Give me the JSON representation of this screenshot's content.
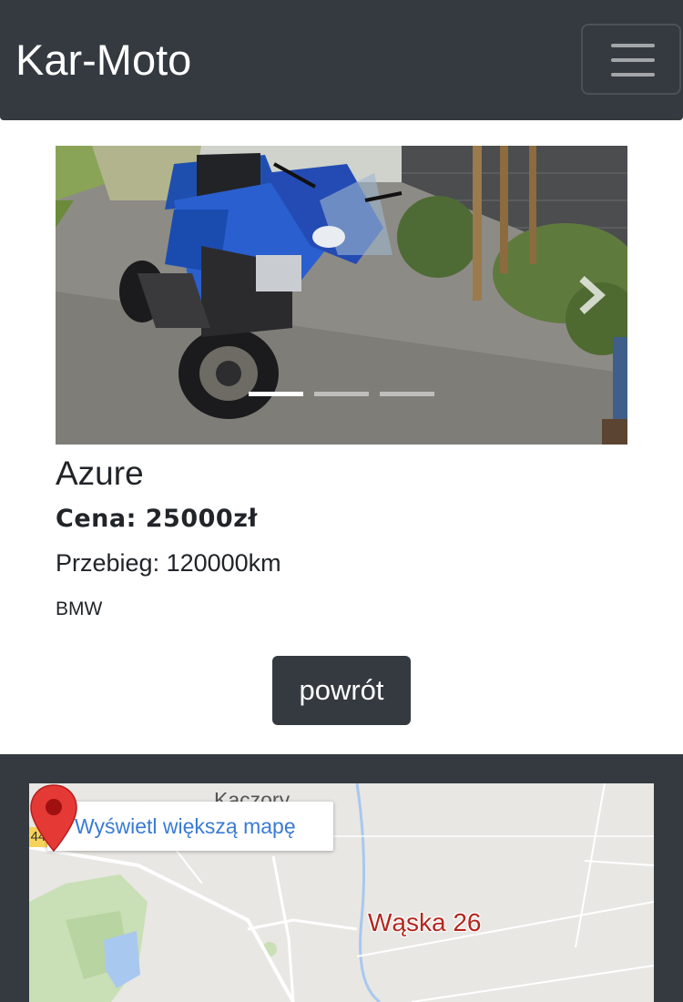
{
  "header": {
    "brand": "Kar-Moto",
    "menu_icon": "hamburger-menu-icon"
  },
  "carousel": {
    "slide_count": 3,
    "active_index": 0,
    "next_icon": "chevron-right-icon"
  },
  "listing": {
    "title": "Azure",
    "price": "Cena: 25000zł",
    "mileage": "Przebieg: 120000km",
    "make": "BMW",
    "back_label": "powrót"
  },
  "map": {
    "link_label": "Wyświetl większą mapę",
    "place_label": "Kaczory",
    "route_number": "44",
    "pin_label": "Wąska 26",
    "pin_icon": "map-pin-icon"
  },
  "colors": {
    "dark": "#343a40",
    "link": "#3a7bd5",
    "pin": "#e53935"
  }
}
